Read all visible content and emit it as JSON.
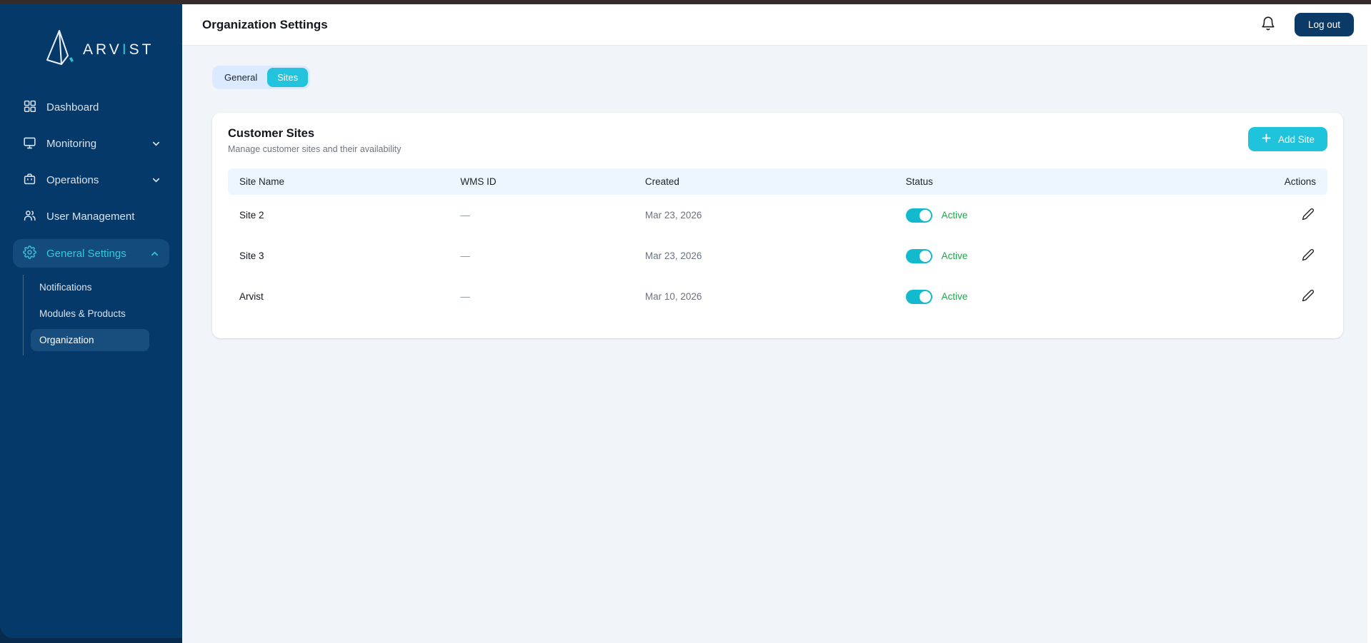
{
  "colors": {
    "accent_cyan": "#1fc3dc",
    "sidebar_navy": "#05396a",
    "logout_navy": "#0b3a67",
    "active_green": "#1ea64b",
    "table_header_bg": "#edf5fe"
  },
  "sidebar": {
    "brand": {
      "pre": "ARV",
      "accent": "I",
      "post": "ST"
    },
    "items": [
      {
        "label": "Dashboard",
        "icon": "grid-icon"
      },
      {
        "label": "Monitoring",
        "icon": "monitor-icon",
        "chevron": "down"
      },
      {
        "label": "Operations",
        "icon": "briefcase-icon",
        "chevron": "down"
      },
      {
        "label": "User Management",
        "icon": "users-icon"
      },
      {
        "label": "General Settings",
        "icon": "gear-icon",
        "chevron": "up",
        "active": true
      }
    ],
    "subitems": [
      {
        "label": "Notifications"
      },
      {
        "label": "Modules & Products"
      },
      {
        "label": "Organization",
        "selected": true
      }
    ]
  },
  "header": {
    "title": "Organization Settings",
    "logout_label": "Log out"
  },
  "tabs": [
    {
      "label": "General",
      "active": false
    },
    {
      "label": "Sites",
      "active": true
    }
  ],
  "card": {
    "title": "Customer Sites",
    "subtitle": "Manage customer sites and their availability",
    "add_button_label": "Add Site",
    "table": {
      "columns": [
        "Site Name",
        "WMS ID",
        "Created",
        "Status",
        "Actions"
      ],
      "rows": [
        {
          "site_name": "Site 2",
          "wms_id": "—",
          "created": "Mar 23, 2026",
          "status": "Active",
          "toggle_on": true
        },
        {
          "site_name": "Site 3",
          "wms_id": "—",
          "created": "Mar 23, 2026",
          "status": "Active",
          "toggle_on": true
        },
        {
          "site_name": "Arvist",
          "wms_id": "—",
          "created": "Mar 10, 2026",
          "status": "Active",
          "toggle_on": true
        }
      ]
    }
  }
}
